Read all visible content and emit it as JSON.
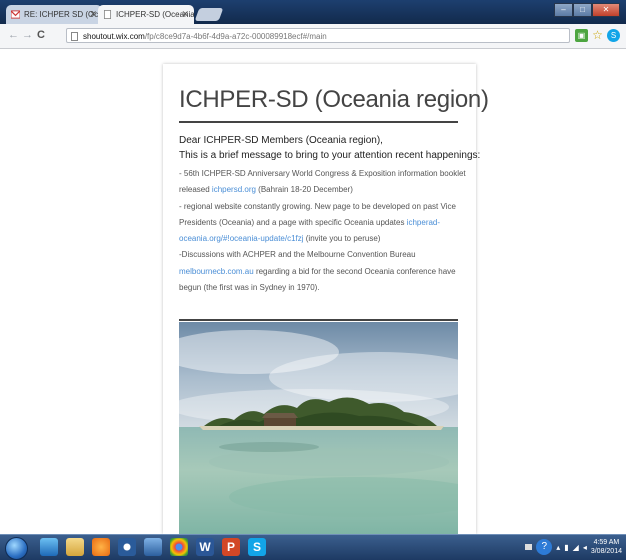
{
  "browser": {
    "tabs": [
      {
        "label": "RE: ICHPER SD (Oceania r",
        "icon": "gmail-icon"
      },
      {
        "label": "ICHPER-SD (Oceania regi",
        "icon": "page-icon"
      }
    ],
    "address": {
      "host": "shoutout.wix.com",
      "path": "/fp/c8ce9d7a-4b6f-4d9a-a72c-000089918ecf#/main"
    }
  },
  "page": {
    "title": "ICHPER-SD (Oceania region)",
    "greeting": "Dear ICHPER-SD Members (Oceania region),",
    "intro": "This is a brief message to bring to your attention recent happenings:",
    "lines": {
      "l1": "- 56th ICHPER-SD Anniversary World Congress & Exposition information booklet",
      "l2_pre": "released ",
      "l2_link": "ichpersd.org",
      "l2_post": " (Bahrain 18-20 December)",
      "l3": "- regional website constantly growing. New page to be developed on past Vice",
      "l4_pre": "Presidents (Oceania) and a page with specific Oceania updates ",
      "l4_link": "ichperad-",
      "l5_link": "oceania.org/#!oceania-update/c1fzj",
      "l5_post": " (invite you to peruse)",
      "l6": "-Discussions with ACHPER and the Melbourne Convention Bureau",
      "l7_link": "melbournecb.com.au",
      "l7_post": " regarding a bid for the second Oceania conference have",
      "l8": "begun (the first was in Sydney in 1970)."
    },
    "photo": "island-photo"
  },
  "taskbar": {
    "time": "4:59 AM",
    "date": "3/08/2014"
  }
}
